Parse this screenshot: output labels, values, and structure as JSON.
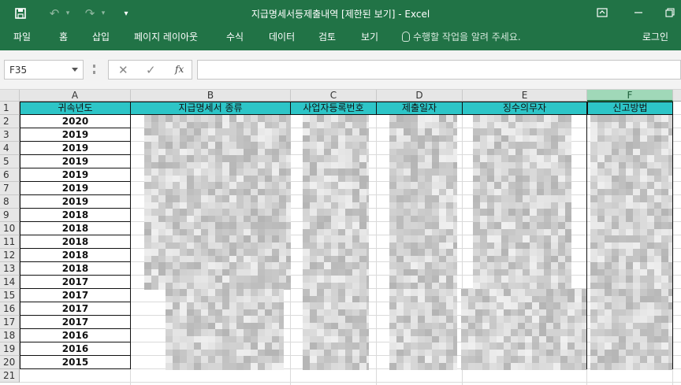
{
  "titlebar": {
    "title": "지급명세서등제출내역  [제한된 보기] - Excel",
    "save_icon": "save-icon",
    "undo_icon": "undo-icon",
    "redo_icon": "redo-icon",
    "customize_icon": "customize-qat-icon",
    "ribbon_display_icon": "ribbon-display-options-icon",
    "minimize_icon": "minimize-icon",
    "restore_icon": "restore-icon"
  },
  "ribbon": {
    "tabs": [
      "파일",
      "홈",
      "삽입",
      "페이지 레이아웃",
      "수식",
      "데이터",
      "검토",
      "보기"
    ],
    "tell_me": "수행할 작업을 알려 주세요.",
    "login": "로그인"
  },
  "formula_bar": {
    "name_box": "F35",
    "cancel_glyph": "✕",
    "enter_glyph": "✓",
    "fx_label": "fx",
    "formula": ""
  },
  "sheet": {
    "columns": [
      "A",
      "B",
      "C",
      "D",
      "E",
      "F"
    ],
    "selected_column": "F",
    "row_numbers": [
      "1",
      "2",
      "3",
      "4",
      "5",
      "6",
      "7",
      "8",
      "9",
      "10",
      "11",
      "12",
      "13",
      "14",
      "15",
      "16",
      "17",
      "18",
      "19",
      "20",
      "21"
    ],
    "headers": [
      "귀속년도",
      "지급명세서 종류",
      "사업자등록번호",
      "제출일자",
      "징수의무자",
      "신고방법"
    ],
    "years": [
      "2020",
      "2019",
      "2019",
      "2019",
      "2019",
      "2019",
      "2019",
      "2018",
      "2018",
      "2018",
      "2018",
      "2018",
      "2017",
      "2017",
      "2017",
      "2017",
      "2016",
      "2016",
      "2015"
    ]
  },
  "colors": {
    "excel_green": "#217346",
    "header_fill": "#2dc5c7",
    "selected_col_header": "#a0d8b8"
  }
}
